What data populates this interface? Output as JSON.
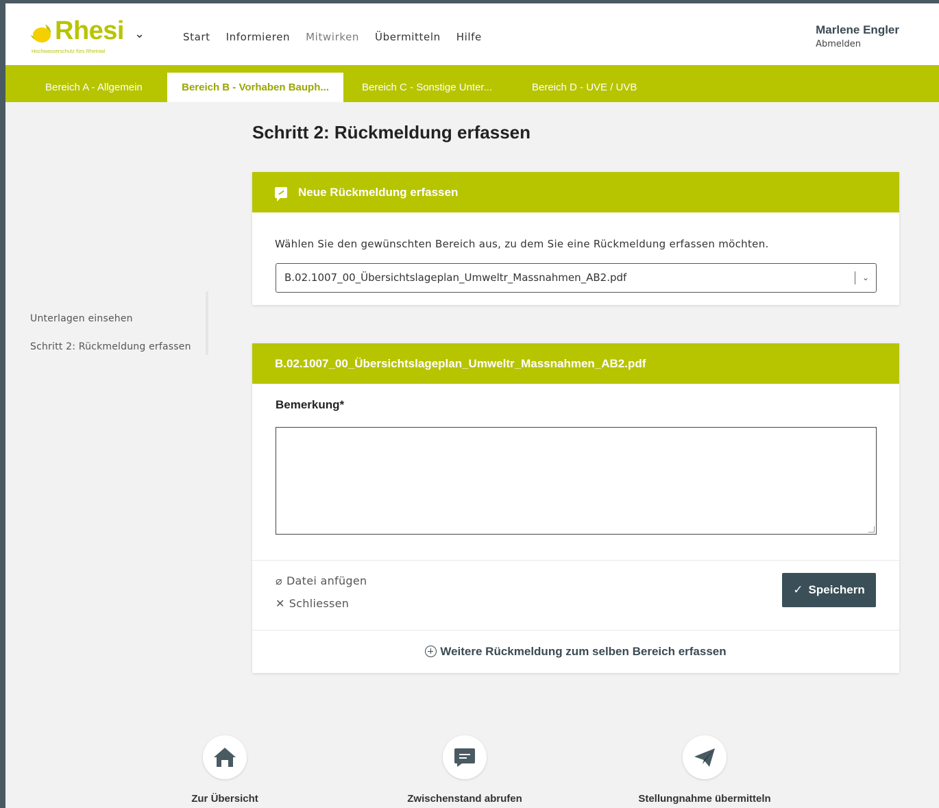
{
  "brand": {
    "name": "Rhesi",
    "tagline": "Hochwasserschutz fürs Rheintal",
    "color": "#b7c400"
  },
  "nav": {
    "items": [
      "Start",
      "Informieren",
      "Mitwirken",
      "Übermitteln",
      "Hilfe"
    ],
    "active": "Mitwirken"
  },
  "user": {
    "name": "Marlene Engler",
    "logout": "Abmelden"
  },
  "tabs": [
    {
      "label": "Bereich A - Allgemein",
      "active": false
    },
    {
      "label": "Bereich B - Vorhaben Bauph...",
      "active": true
    },
    {
      "label": "Bereich C - Sonstige Unter...",
      "active": false
    },
    {
      "label": "Bereich D - UVE / UVB",
      "active": false
    }
  ],
  "page_title": "Schritt 2: Rückmeldung erfassen",
  "sidenav": {
    "items": [
      "Unterlagen einsehen",
      "Schritt 2: Rückmeldung erfassen"
    ]
  },
  "new_feedback": {
    "title": "Neue Rückmeldung erfassen",
    "prompt": "Wählen Sie den gewünschten Bereich aus, zu dem Sie eine Rückmeldung erfassen möchten.",
    "selected": "B.02.1007_00_Übersichtslageplan_Umweltr_Massnahmen_AB2.pdf"
  },
  "feedback_form": {
    "title": "B.02.1007_00_Übersichtslageplan_Umweltr_Massnahmen_AB2.pdf",
    "remark_label": "Bemerkung*",
    "remark_value": "",
    "attach_label": "Datei anfügen",
    "close_label": "Schliessen",
    "save_label": "Speichern",
    "more_label": "Weitere Rückmeldung zum selben Bereich erfassen"
  },
  "footer": {
    "overview": "Zur Übersicht",
    "interim": "Zwischenstand abrufen",
    "submit": "Stellungnahme übermitteln"
  },
  "colors": {
    "accent": "#b7c400",
    "button": "#3a4f57"
  }
}
